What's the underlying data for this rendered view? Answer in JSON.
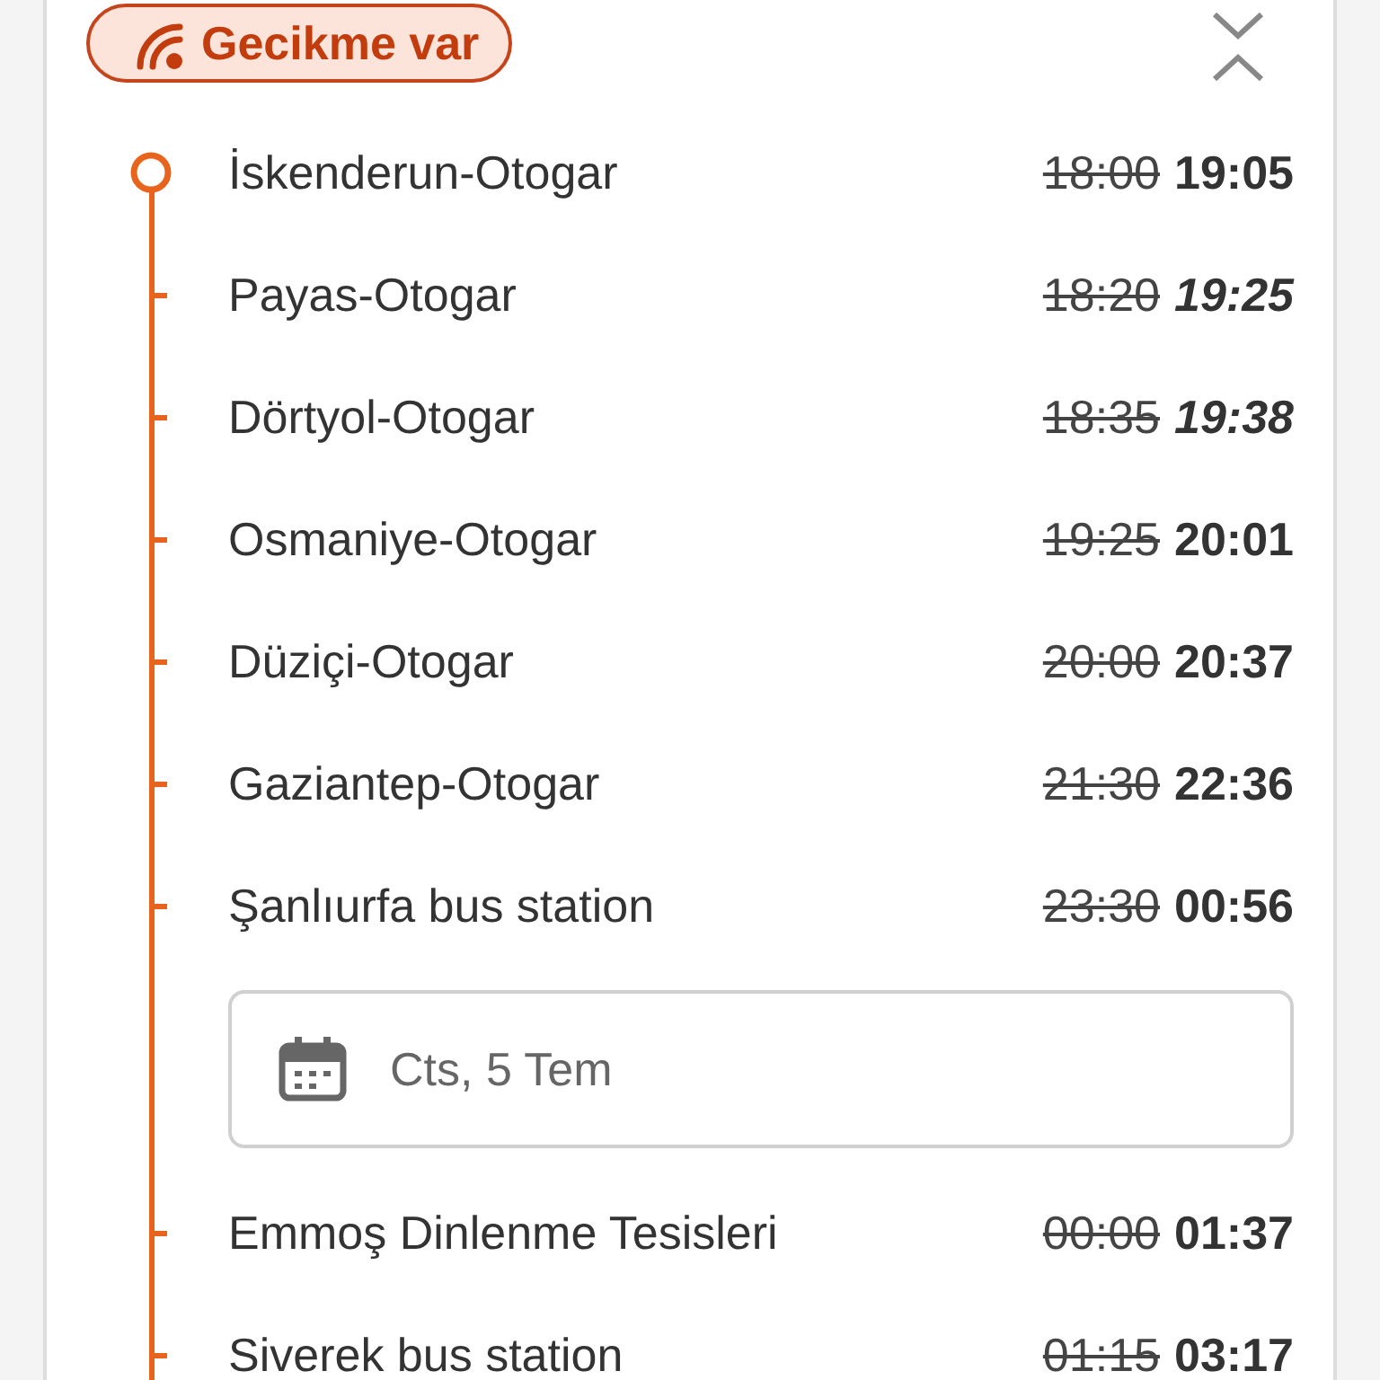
{
  "status_badge": {
    "label": "Gecikme var"
  },
  "stops": [
    {
      "kind": "origin",
      "name": "İskenderun-Otogar",
      "scheduled": "18:00",
      "actual": "19:05",
      "estimated": false
    },
    {
      "kind": "stop",
      "name": "Payas-Otogar",
      "scheduled": "18:20",
      "actual": "19:25",
      "estimated": true
    },
    {
      "kind": "stop",
      "name": "Dörtyol-Otogar",
      "scheduled": "18:35",
      "actual": "19:38",
      "estimated": true
    },
    {
      "kind": "stop",
      "name": "Osmaniye-Otogar",
      "scheduled": "19:25",
      "actual": "20:01",
      "estimated": false
    },
    {
      "kind": "stop",
      "name": "Düziçi-Otogar",
      "scheduled": "20:00",
      "actual": "20:37",
      "estimated": false
    },
    {
      "kind": "stop",
      "name": "Gaziantep-Otogar",
      "scheduled": "21:30",
      "actual": "22:36",
      "estimated": false
    },
    {
      "kind": "stop",
      "name": "Şanlıurfa bus station",
      "scheduled": "23:30",
      "actual": "00:56",
      "estimated": false
    },
    {
      "kind": "date",
      "label": "Cts, 5 Tem"
    },
    {
      "kind": "stop",
      "name": "Emmoş Dinlenme Tesisleri",
      "scheduled": "00:00",
      "actual": "01:37",
      "estimated": false
    },
    {
      "kind": "stop",
      "name": "Siverek bus station",
      "scheduled": "01:15",
      "actual": "03:17",
      "estimated": false
    }
  ]
}
